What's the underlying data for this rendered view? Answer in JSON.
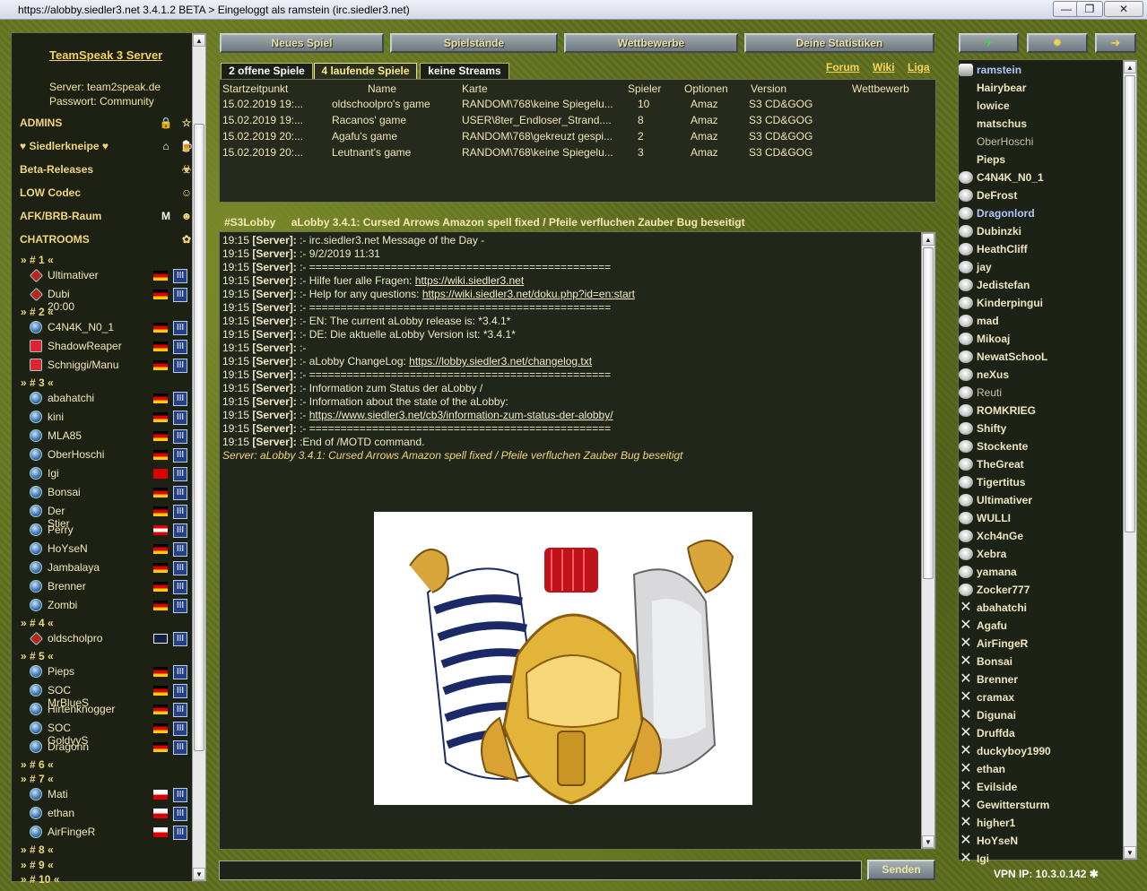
{
  "window": {
    "title": "https://alobby.siedler3.net 3.4.1.2 BETA > Eingeloggt als ramstein (irc.siedler3.net)",
    "min": "—",
    "max": "❐",
    "close": "✕"
  },
  "left": {
    "ts_title": "TeamSpeak 3 Server",
    "ts_server": "Server: team2speak.de",
    "ts_password": "Passwort: Community",
    "rows": [
      {
        "label": "ADMINS",
        "i1": "🔒",
        "i2": "☆"
      },
      {
        "label": "♥ Siedlerkneipe ♥",
        "i1": "⌂",
        "i2": "🍺"
      },
      {
        "label": "Beta-Releases",
        "i1": "",
        "i2": "☣"
      },
      {
        "label": "LOW Codec",
        "i1": "",
        "i2": "☺"
      },
      {
        "label": "AFK/BRB-Raum",
        "i1": "M",
        "i2": "☻"
      },
      {
        "label": "CHATROOMS",
        "i1": "",
        "i2": "✿"
      }
    ],
    "rooms": [
      "» # 1 «",
      "» # 2 «",
      "» # 3 «",
      "» # 4 «",
      "» # 5 «",
      "» # 6 «",
      "» # 7 «",
      "» # 8 «",
      "» # 9 «",
      "» # 10 «"
    ],
    "users": [
      {
        "name": "Ultimativer",
        "icon": "sword",
        "flag": "de"
      },
      {
        "name": "Dubi 20:00",
        "icon": "sword",
        "flag": "de"
      },
      {
        "name": "C4N4K_N0_1",
        "icon": "",
        "flag": "de"
      },
      {
        "name": "ShadowReaper",
        "icon": "red",
        "flag": "de"
      },
      {
        "name": "Schniggi/Manu",
        "icon": "red",
        "flag": "de"
      },
      {
        "name": "abahatchi",
        "icon": "",
        "flag": "de"
      },
      {
        "name": "kini",
        "icon": "",
        "flag": "de"
      },
      {
        "name": "MLA85",
        "icon": "",
        "flag": "de"
      },
      {
        "name": "OberHoschi",
        "icon": "",
        "flag": "de"
      },
      {
        "name": "Igi",
        "icon": "",
        "flag": "ch"
      },
      {
        "name": "Bonsai",
        "icon": "",
        "flag": "de"
      },
      {
        "name": "Der Stier",
        "icon": "",
        "flag": "de"
      },
      {
        "name": "Perry",
        "icon": "",
        "flag": "at"
      },
      {
        "name": "HoYseN",
        "icon": "",
        "flag": "de"
      },
      {
        "name": "Jambalaya",
        "icon": "",
        "flag": "de"
      },
      {
        "name": "Brenner",
        "icon": "",
        "flag": "de"
      },
      {
        "name": "Zombi",
        "icon": "",
        "flag": "de"
      },
      {
        "name": "oldscholpro",
        "icon": "sword",
        "flag": "uk"
      },
      {
        "name": "Pieps",
        "icon": "",
        "flag": "de"
      },
      {
        "name": "SOC MrBlueS",
        "icon": "",
        "flag": "de"
      },
      {
        "name": "Hirtenknogger",
        "icon": "",
        "flag": "de"
      },
      {
        "name": "SOC GoldyyS",
        "icon": "",
        "flag": "de"
      },
      {
        "name": "Dragonn",
        "icon": "",
        "flag": "de"
      },
      {
        "name": "Mati",
        "icon": "",
        "flag": "pl"
      },
      {
        "name": "ethan",
        "icon": "",
        "flag": "pl"
      },
      {
        "name": "AirFingeR",
        "icon": "",
        "flag": "pl"
      }
    ]
  },
  "nav": [
    "Neues Spiel",
    "Spielstände",
    "Wettbewerbe",
    "Deine Statistiken"
  ],
  "tabs": [
    "2 offene Spiele",
    "4 laufende Spiele",
    "keine Streams"
  ],
  "links": [
    "Forum",
    "Wiki",
    "Liga"
  ],
  "games": {
    "headers": [
      "Startzeitpunkt",
      "Name",
      "Karte",
      "Spieler",
      "Optionen",
      "Version",
      "Wettbewerb"
    ],
    "rows": [
      [
        "15.02.2019 19:...",
        "oldschoolpro's game",
        "RANDOM\\768\\keine Spiegelu...",
        "10",
        "Amaz",
        "S3 CD&GOG",
        ""
      ],
      [
        "15.02.2019 19:...",
        "Racanos' game",
        "USER\\8ter_Endloser_Strand....",
        "8",
        "Amaz",
        "S3 CD&GOG",
        ""
      ],
      [
        "15.02.2019 20:...",
        "Agafu's game",
        "RANDOM\\768\\gekreuzt gespi...",
        "2",
        "Amaz",
        "S3 CD&GOG",
        ""
      ],
      [
        "15.02.2019 20:...",
        "Leutnant's game",
        "RANDOM\\768\\keine Spiegelu...",
        "3",
        "Amaz",
        "S3 CD&GOG",
        ""
      ]
    ]
  },
  "channel": {
    "name": "#S3Lobby",
    "topic": "aLobby 3.4.1: Cursed Arrows Amazon spell fixed / Pfeile verfluchen Zauber Bug beseitigt"
  },
  "chat": [
    {
      "t": "19:15",
      "s": "[Server]:",
      "m": ":- irc.siedler3.net Message of the Day -",
      "l": ""
    },
    {
      "t": "19:15",
      "s": "[Server]:",
      "m": ":- 9/2/2019 11:31",
      "l": ""
    },
    {
      "t": "19:15",
      "s": "[Server]:",
      "m": ":- ================================================",
      "l": ""
    },
    {
      "t": "19:15",
      "s": "[Server]:",
      "m": ":- Hilfe fuer alle Fragen: ",
      "l": "https://wiki.siedler3.net"
    },
    {
      "t": "19:15",
      "s": "[Server]:",
      "m": ":- Help for any questions: ",
      "l": "https://wiki.siedler3.net/doku.php?id=en:start"
    },
    {
      "t": "19:15",
      "s": "[Server]:",
      "m": ":- ================================================",
      "l": ""
    },
    {
      "t": "19:15",
      "s": "[Server]:",
      "m": ":- EN: The current aLobby release is: *3.4.1*",
      "l": ""
    },
    {
      "t": "19:15",
      "s": "[Server]:",
      "m": ":- DE: Die aktuelle aLobby Version ist: *3.4.1*",
      "l": ""
    },
    {
      "t": "19:15",
      "s": "[Server]:",
      "m": ":-",
      "l": ""
    },
    {
      "t": "19:15",
      "s": "[Server]:",
      "m": ":- aLobby ChangeLog: ",
      "l": "https://lobby.siedler3.net/changelog.txt"
    },
    {
      "t": "19:15",
      "s": "[Server]:",
      "m": ":- ================================================",
      "l": ""
    },
    {
      "t": "19:15",
      "s": "[Server]:",
      "m": ":- Information zum Status der aLobby /",
      "l": ""
    },
    {
      "t": "19:15",
      "s": "[Server]:",
      "m": ":- Information about the state of the aLobby:",
      "l": ""
    },
    {
      "t": "19:15",
      "s": "[Server]:",
      "m": ":- ",
      "l": "https://www.siedler3.net/cb3/information-zum-status-der-alobby/"
    },
    {
      "t": "19:15",
      "s": "[Server]:",
      "m": ":- ================================================",
      "l": ""
    },
    {
      "t": "19:15",
      "s": "[Server]:",
      "m": ":End of /MOTD command.",
      "l": ""
    }
  ],
  "chat_topic": "Server: aLobby 3.4.1: Cursed Arrows Amazon spell fixed / Pfeile verfluchen Zauber Bug beseitigt",
  "send": "Senden",
  "right_buttons": [
    "✈",
    "✹",
    "➜"
  ],
  "right_users": [
    {
      "n": "ramstein",
      "k": "shield",
      "c": "blue"
    },
    {
      "n": "Hairybear",
      "k": "none",
      "c": ""
    },
    {
      "n": "lowice",
      "k": "none",
      "c": ""
    },
    {
      "n": "matschus",
      "k": "none",
      "c": ""
    },
    {
      "n": "OberHoschi",
      "k": "none",
      "c": "grey"
    },
    {
      "n": "Pieps",
      "k": "none",
      "c": ""
    },
    {
      "n": "C4N4K_N0_1",
      "k": "h",
      "c": ""
    },
    {
      "n": "DeFrost",
      "k": "h",
      "c": ""
    },
    {
      "n": "Dragonlord",
      "k": "h",
      "c": "blue"
    },
    {
      "n": "Dubinzki",
      "k": "h",
      "c": ""
    },
    {
      "n": "HeathCliff",
      "k": "h",
      "c": ""
    },
    {
      "n": "jay",
      "k": "h",
      "c": ""
    },
    {
      "n": "Jedistefan",
      "k": "h",
      "c": ""
    },
    {
      "n": "Kinderpingui",
      "k": "h",
      "c": ""
    },
    {
      "n": "mad",
      "k": "h",
      "c": ""
    },
    {
      "n": "Mikoaj",
      "k": "h",
      "c": ""
    },
    {
      "n": "NewatSchooL",
      "k": "h",
      "c": ""
    },
    {
      "n": "neXus",
      "k": "h",
      "c": ""
    },
    {
      "n": "Reuti",
      "k": "h",
      "c": "grey"
    },
    {
      "n": "ROMKRIEG",
      "k": "h",
      "c": ""
    },
    {
      "n": "Shifty",
      "k": "h",
      "c": ""
    },
    {
      "n": "Stockente",
      "k": "h",
      "c": ""
    },
    {
      "n": "TheGreat",
      "k": "h",
      "c": ""
    },
    {
      "n": "Tigertitus",
      "k": "h",
      "c": ""
    },
    {
      "n": "Ultimativer",
      "k": "h",
      "c": ""
    },
    {
      "n": "WULLI",
      "k": "h",
      "c": ""
    },
    {
      "n": "Xch4nGe",
      "k": "h",
      "c": ""
    },
    {
      "n": "Xebra",
      "k": "h",
      "c": ""
    },
    {
      "n": "yamana",
      "k": "h",
      "c": ""
    },
    {
      "n": "Zocker777",
      "k": "h",
      "c": ""
    },
    {
      "n": "abahatchi",
      "k": "x",
      "c": ""
    },
    {
      "n": "Agafu",
      "k": "x",
      "c": ""
    },
    {
      "n": "AirFingeR",
      "k": "x",
      "c": ""
    },
    {
      "n": "Bonsai",
      "k": "x",
      "c": ""
    },
    {
      "n": "Brenner",
      "k": "x",
      "c": ""
    },
    {
      "n": "cramax",
      "k": "x",
      "c": ""
    },
    {
      "n": "Digunai",
      "k": "x",
      "c": ""
    },
    {
      "n": "Druffda",
      "k": "x",
      "c": ""
    },
    {
      "n": "duckyboy1990",
      "k": "x",
      "c": ""
    },
    {
      "n": "ethan",
      "k": "x",
      "c": ""
    },
    {
      "n": "Evilside",
      "k": "x",
      "c": ""
    },
    {
      "n": "Gewittersturm",
      "k": "x",
      "c": ""
    },
    {
      "n": "higher1",
      "k": "x",
      "c": ""
    },
    {
      "n": "HoYseN",
      "k": "x",
      "c": ""
    },
    {
      "n": "Igi",
      "k": "x",
      "c": ""
    }
  ],
  "vpn": "VPN IP: 10.3.0.142"
}
